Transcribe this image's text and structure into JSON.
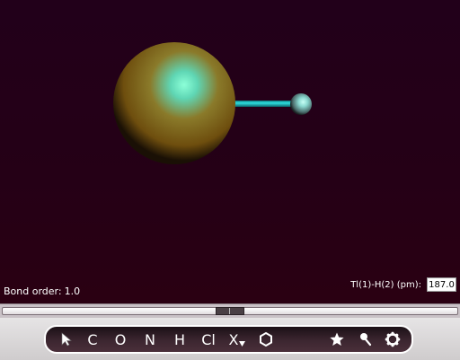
{
  "status": {
    "bond_order_label": "Bond order:",
    "bond_order_value": "1.0",
    "bond_length_label": "Tl(1)-H(2) (pm):",
    "bond_length_value": "187.0"
  },
  "molecule": {
    "atoms": [
      "Tl(1)",
      "H(2)"
    ],
    "bond": "Tl(1)-H(2)",
    "colors": {
      "thallium": "#8a6a14",
      "thallium_highlight": "#7fffd0",
      "hydrogen": "#e8f0f0",
      "bond": "#19c3c3",
      "background": "#22001a"
    }
  },
  "toolbar": {
    "tools": [
      {
        "label": "",
        "icon": "cursor-arrow-icon"
      },
      {
        "label": "C"
      },
      {
        "label": "O"
      },
      {
        "label": "N"
      },
      {
        "label": "H"
      },
      {
        "label": "Cl"
      },
      {
        "label": "X"
      },
      {
        "label": "",
        "icon": "ring-hexagon-icon"
      },
      {
        "label": "",
        "icon": "star-icon"
      },
      {
        "label": "",
        "icon": "pin-icon"
      },
      {
        "label": "",
        "icon": "gear-icon"
      }
    ]
  },
  "slider": {
    "value_fraction": 0.5
  }
}
